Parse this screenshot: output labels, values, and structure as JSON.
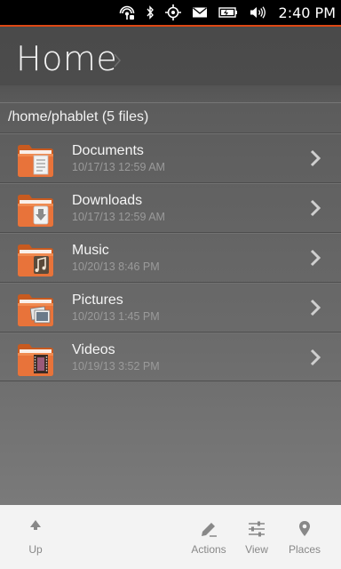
{
  "status_bar": {
    "time": "2:40 PM",
    "icons": [
      "hotspot-icon",
      "bluetooth-icon",
      "location-icon",
      "mail-icon",
      "battery-icon",
      "volume-icon"
    ]
  },
  "header": {
    "title": "Home"
  },
  "path": "/home/phablet (5 files)",
  "files": [
    {
      "name": "Documents",
      "date": "10/17/13 12:59 AM",
      "icon": "documents-folder-icon"
    },
    {
      "name": "Downloads",
      "date": "10/17/13 12:59 AM",
      "icon": "downloads-folder-icon"
    },
    {
      "name": "Music",
      "date": "10/20/13 8:46 PM",
      "icon": "music-folder-icon"
    },
    {
      "name": "Pictures",
      "date": "10/20/13 1:45 PM",
      "icon": "pictures-folder-icon"
    },
    {
      "name": "Videos",
      "date": "10/19/13 3:52 PM",
      "icon": "videos-folder-icon"
    }
  ],
  "toolbar": {
    "up_label": "Up",
    "actions_label": "Actions",
    "view_label": "View",
    "places_label": "Places"
  },
  "colors": {
    "accent": "#dd4814",
    "folder_orange": "#e8733a",
    "background": "#5e5e5e",
    "toolbar": "#f3f3f3"
  }
}
